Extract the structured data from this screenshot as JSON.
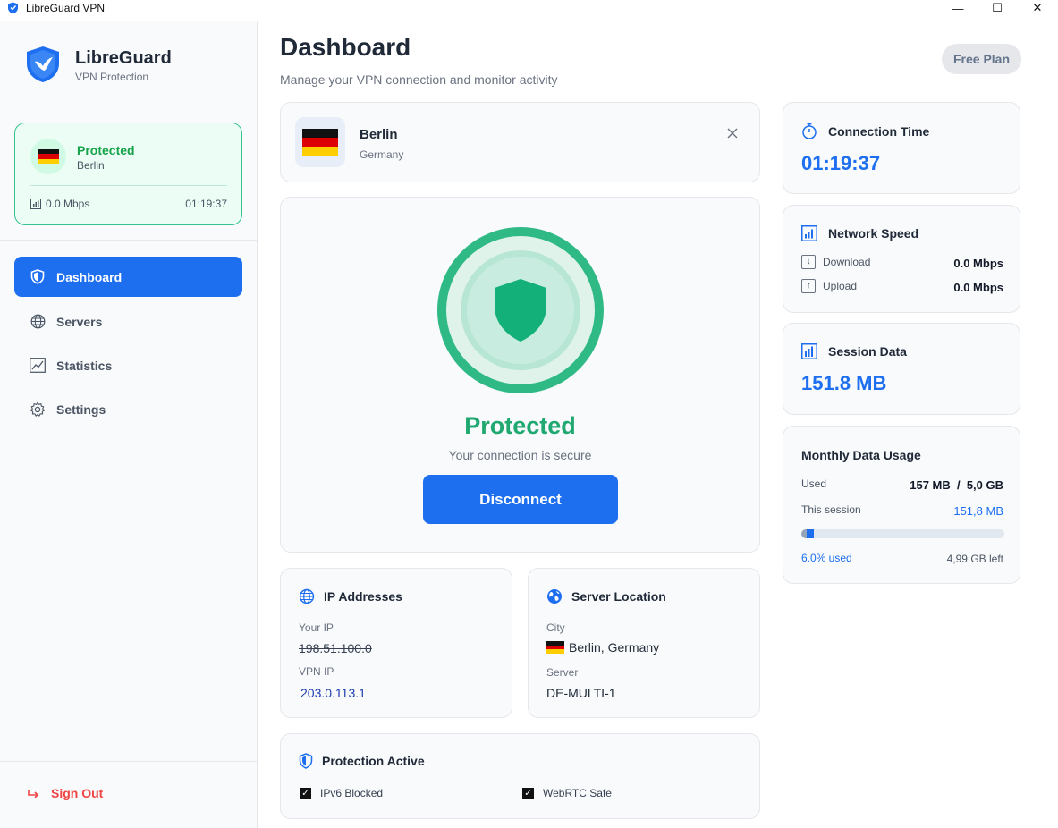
{
  "window": {
    "title": "LibreGuard VPN",
    "minimize": "—",
    "maximize": "☐",
    "close": "✕"
  },
  "sidebar": {
    "brand_name": "LibreGuard",
    "brand_sub": "VPN Protection",
    "status": {
      "title": "Protected",
      "city": "Berlin",
      "speed": "0.0 Mbps",
      "time": "01:19:37"
    },
    "nav": [
      {
        "label": "Dashboard",
        "icon": "shield-icon",
        "active": true
      },
      {
        "label": "Servers",
        "icon": "globe-icon",
        "active": false
      },
      {
        "label": "Statistics",
        "icon": "chart-icon",
        "active": false
      },
      {
        "label": "Settings",
        "icon": "gear-icon",
        "active": false
      }
    ],
    "sign_out": "Sign Out"
  },
  "header": {
    "title": "Dashboard",
    "subtitle": "Manage your VPN connection and monitor activity",
    "plan": "Free Plan"
  },
  "location": {
    "city": "Berlin",
    "country": "Germany"
  },
  "protection": {
    "status": "Protected",
    "message": "Your connection is secure",
    "button": "Disconnect"
  },
  "ip": {
    "title": "IP Addresses",
    "your_ip_label": "Your IP",
    "your_ip": "198.51.100.0",
    "vpn_ip_label": "VPN IP",
    "vpn_ip": "203.0.113.1"
  },
  "server_location": {
    "title": "Server Location",
    "city_label": "City",
    "city": "Berlin, Germany",
    "server_label": "Server",
    "server": "DE-MULTI-1"
  },
  "protection_active": {
    "title": "Protection Active",
    "items": [
      "IPv6 Blocked",
      "WebRTC Safe"
    ]
  },
  "connection_time": {
    "title": "Connection Time",
    "value": "01:19:37"
  },
  "network_speed": {
    "title": "Network Speed",
    "download_label": "Download",
    "download": "0.0 Mbps",
    "upload_label": "Upload",
    "upload": "0.0 Mbps"
  },
  "session_data": {
    "title": "Session Data",
    "value": "151.8 MB"
  },
  "monthly_usage": {
    "title": "Monthly Data Usage",
    "used_label": "Used",
    "used": "157 MB  /  5,0 GB",
    "session_label": "This session",
    "session": "151,8 MB",
    "percent_text": "6.0% used",
    "left_text": "4,99 GB left",
    "used_fraction": 0.06
  },
  "colors": {
    "accent": "#1d6ff0",
    "success": "#1fa870",
    "danger": "#ef4444"
  }
}
